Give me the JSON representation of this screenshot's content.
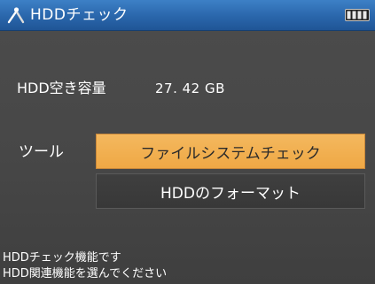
{
  "titlebar": {
    "title": "HDDチェック",
    "icon": "tools-icon",
    "battery_icon": "battery-icon"
  },
  "info": {
    "label": "HDD空き容量",
    "value": "27. 42 GB"
  },
  "tools": {
    "label": "ツール",
    "buttons": [
      {
        "label": "ファイルシステムチェック",
        "state": "selected"
      },
      {
        "label": "HDDのフォーマット",
        "state": "normal"
      }
    ]
  },
  "status": {
    "line1": "HDDチェック機能です",
    "line2": "HDD関連機能を選んでください"
  },
  "colors": {
    "titlebar": "#2a66ab",
    "highlight": "#efa845",
    "background": "#4a4a4a"
  }
}
